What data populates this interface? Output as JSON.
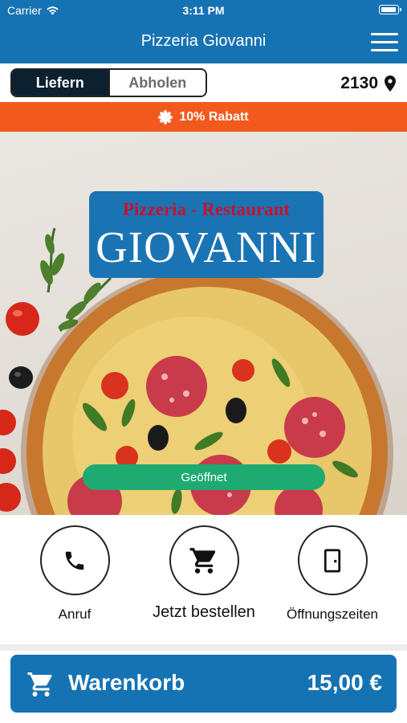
{
  "status_bar": {
    "carrier": "Carrier",
    "time": "3:11 PM"
  },
  "header": {
    "title": "Pizzeria Giovanni"
  },
  "mode": {
    "deliver_label": "Liefern",
    "pickup_label": "Abholen",
    "postal_code": "2130"
  },
  "promo": {
    "text": "10% Rabatt"
  },
  "hero": {
    "logo_subtitle": "Pizzeria - Restaurant",
    "logo_title": "GIOVANNI",
    "open_status": "Geöffnet"
  },
  "actions": {
    "call_label": "Anruf",
    "order_label": "Jetzt bestellen",
    "hours_label": "Öffnungszeiten"
  },
  "cart": {
    "label": "Warenkorb",
    "total": "15,00 €"
  },
  "colors": {
    "primary": "#1673b3",
    "promo": "#f25a1d",
    "open": "#1eab72",
    "segment_active": "#0c2030",
    "logo_red": "#c8102e"
  },
  "icons": [
    "wifi-icon",
    "battery-icon",
    "hamburger-menu-icon",
    "location-pin-icon",
    "badge-icon",
    "phone-icon",
    "cart-icon",
    "door-icon"
  ]
}
